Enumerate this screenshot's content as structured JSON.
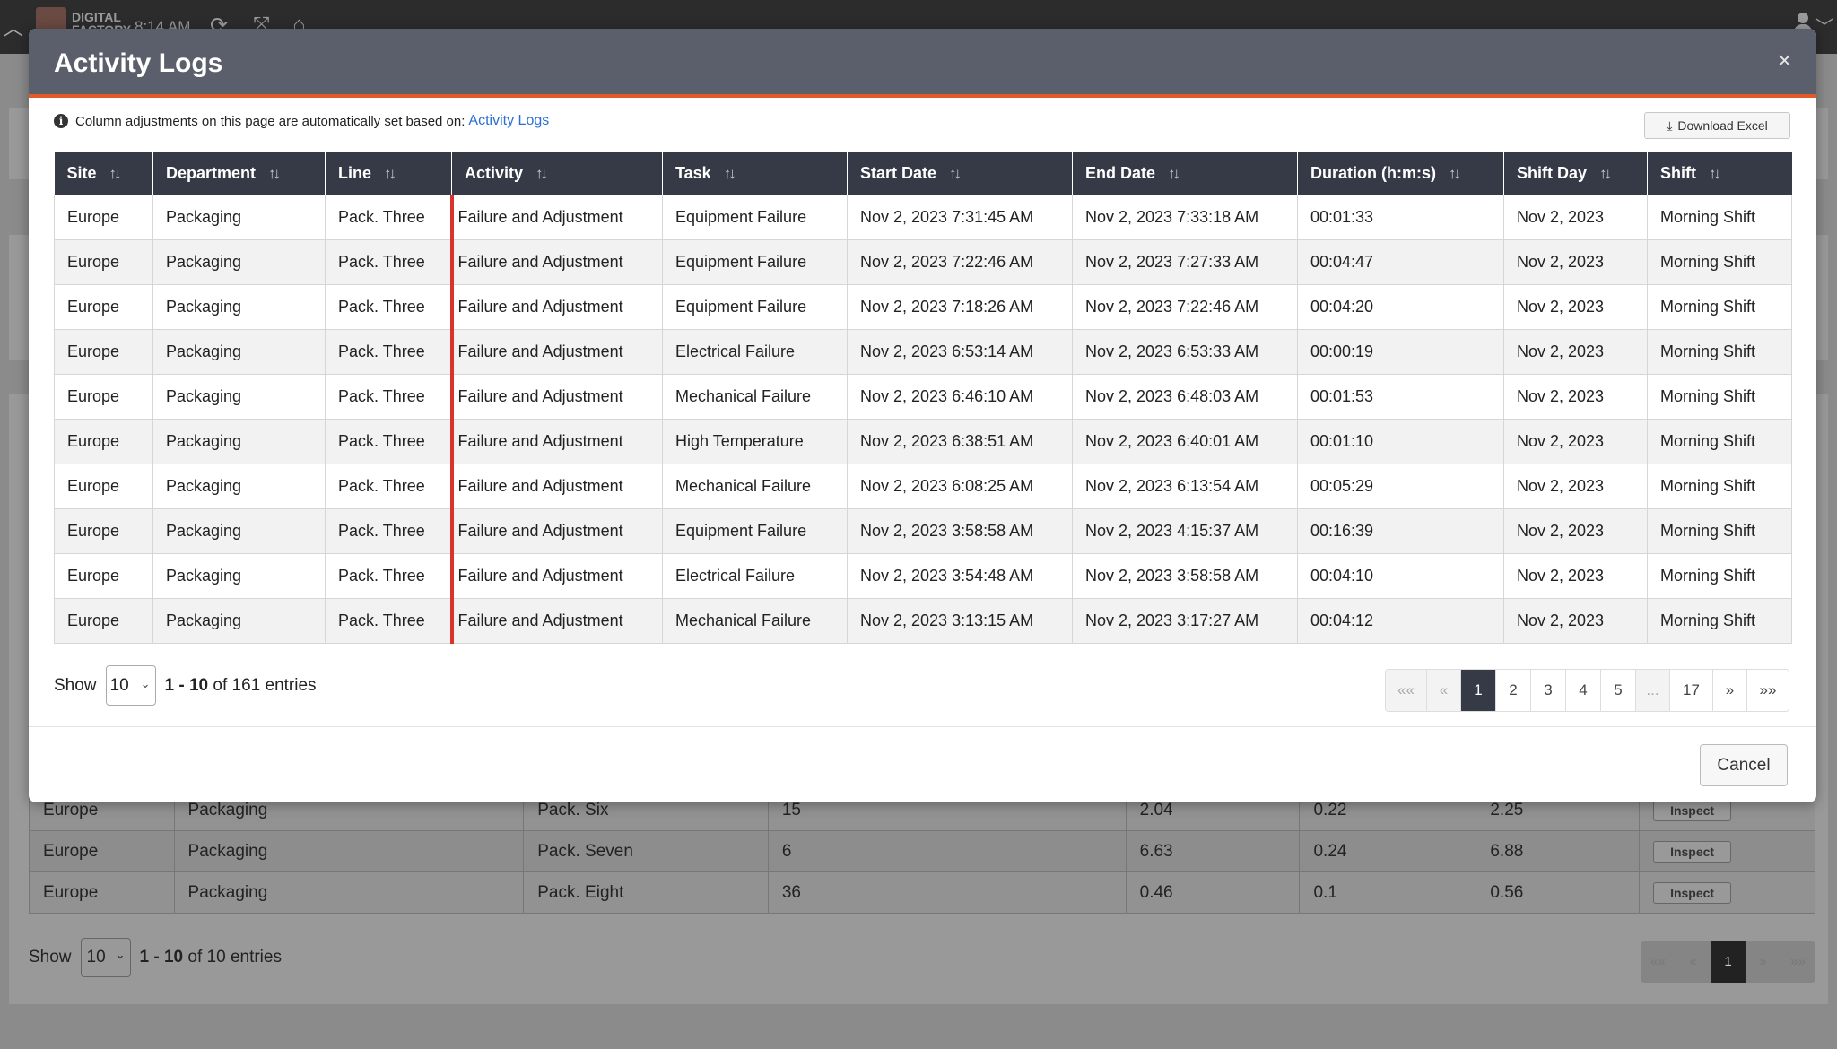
{
  "topbar": {
    "brand_line1": "DIGITAL",
    "brand_line2": "FACTORY",
    "time": "8:14 AM",
    "icons": [
      "chevron-up-icon",
      "logo-icon",
      "refresh-icon",
      "expand-icon",
      "home-icon",
      "user-icon",
      "chevron-down-icon"
    ]
  },
  "modal": {
    "title": "Activity Logs",
    "close_label": "×",
    "info_text": "Column adjustments on this page are automatically set based on:",
    "info_link": "Activity Logs",
    "download_label": "Download Excel",
    "columns": [
      "Site",
      "Department",
      "Line",
      "Activity",
      "Task",
      "Start Date",
      "End Date",
      "Duration (h:m:s)",
      "Shift Day",
      "Shift"
    ],
    "rows": [
      [
        "Europe",
        "Packaging",
        "Pack. Three",
        "Failure and Adjustment",
        "Equipment Failure",
        "Nov 2, 2023 7:31:45 AM",
        "Nov 2, 2023 7:33:18 AM",
        "00:01:33",
        "Nov 2, 2023",
        "Morning Shift"
      ],
      [
        "Europe",
        "Packaging",
        "Pack. Three",
        "Failure and Adjustment",
        "Equipment Failure",
        "Nov 2, 2023 7:22:46 AM",
        "Nov 2, 2023 7:27:33 AM",
        "00:04:47",
        "Nov 2, 2023",
        "Morning Shift"
      ],
      [
        "Europe",
        "Packaging",
        "Pack. Three",
        "Failure and Adjustment",
        "Equipment Failure",
        "Nov 2, 2023 7:18:26 AM",
        "Nov 2, 2023 7:22:46 AM",
        "00:04:20",
        "Nov 2, 2023",
        "Morning Shift"
      ],
      [
        "Europe",
        "Packaging",
        "Pack. Three",
        "Failure and Adjustment",
        "Electrical Failure",
        "Nov 2, 2023 6:53:14 AM",
        "Nov 2, 2023 6:53:33 AM",
        "00:00:19",
        "Nov 2, 2023",
        "Morning Shift"
      ],
      [
        "Europe",
        "Packaging",
        "Pack. Three",
        "Failure and Adjustment",
        "Mechanical Failure",
        "Nov 2, 2023 6:46:10 AM",
        "Nov 2, 2023 6:48:03 AM",
        "00:01:53",
        "Nov 2, 2023",
        "Morning Shift"
      ],
      [
        "Europe",
        "Packaging",
        "Pack. Three",
        "Failure and Adjustment",
        "High Temperature",
        "Nov 2, 2023 6:38:51 AM",
        "Nov 2, 2023 6:40:01 AM",
        "00:01:10",
        "Nov 2, 2023",
        "Morning Shift"
      ],
      [
        "Europe",
        "Packaging",
        "Pack. Three",
        "Failure and Adjustment",
        "Mechanical Failure",
        "Nov 2, 2023 6:08:25 AM",
        "Nov 2, 2023 6:13:54 AM",
        "00:05:29",
        "Nov 2, 2023",
        "Morning Shift"
      ],
      [
        "Europe",
        "Packaging",
        "Pack. Three",
        "Failure and Adjustment",
        "Equipment Failure",
        "Nov 2, 2023 3:58:58 AM",
        "Nov 2, 2023 4:15:37 AM",
        "00:16:39",
        "Nov 2, 2023",
        "Morning Shift"
      ],
      [
        "Europe",
        "Packaging",
        "Pack. Three",
        "Failure and Adjustment",
        "Electrical Failure",
        "Nov 2, 2023 3:54:48 AM",
        "Nov 2, 2023 3:58:58 AM",
        "00:04:10",
        "Nov 2, 2023",
        "Morning Shift"
      ],
      [
        "Europe",
        "Packaging",
        "Pack. Three",
        "Failure and Adjustment",
        "Mechanical Failure",
        "Nov 2, 2023 3:13:15 AM",
        "Nov 2, 2023 3:17:27 AM",
        "00:04:12",
        "Nov 2, 2023",
        "Morning Shift"
      ]
    ],
    "show_label": "Show",
    "page_size": "10",
    "entries_range": "1 - 10",
    "entries_suffix": "of 161 entries",
    "pager": [
      "««",
      "«",
      "1",
      "2",
      "3",
      "4",
      "5",
      "...",
      "17",
      "»",
      "»»"
    ],
    "pager_active": "1",
    "cancel_label": "Cancel",
    "accent_color": "#e05a2b",
    "activity_marker_color": "#d9342b"
  },
  "background": {
    "rows": [
      [
        "Europe",
        "Packaging",
        "Pack. Six",
        "15",
        "2.04",
        "0.22",
        "2.25",
        "Inspect"
      ],
      [
        "Europe",
        "Packaging",
        "Pack. Seven",
        "6",
        "6.63",
        "0.24",
        "6.88",
        "Inspect"
      ],
      [
        "Europe",
        "Packaging",
        "Pack. Eight",
        "36",
        "0.46",
        "0.1",
        "0.56",
        "Inspect"
      ]
    ],
    "show_label": "Show",
    "page_size": "10",
    "entries_range": "1 - 10",
    "entries_suffix": "of 10 entries",
    "pager": [
      "««",
      "«",
      "1",
      "»",
      "»»"
    ],
    "pager_active": "1"
  }
}
